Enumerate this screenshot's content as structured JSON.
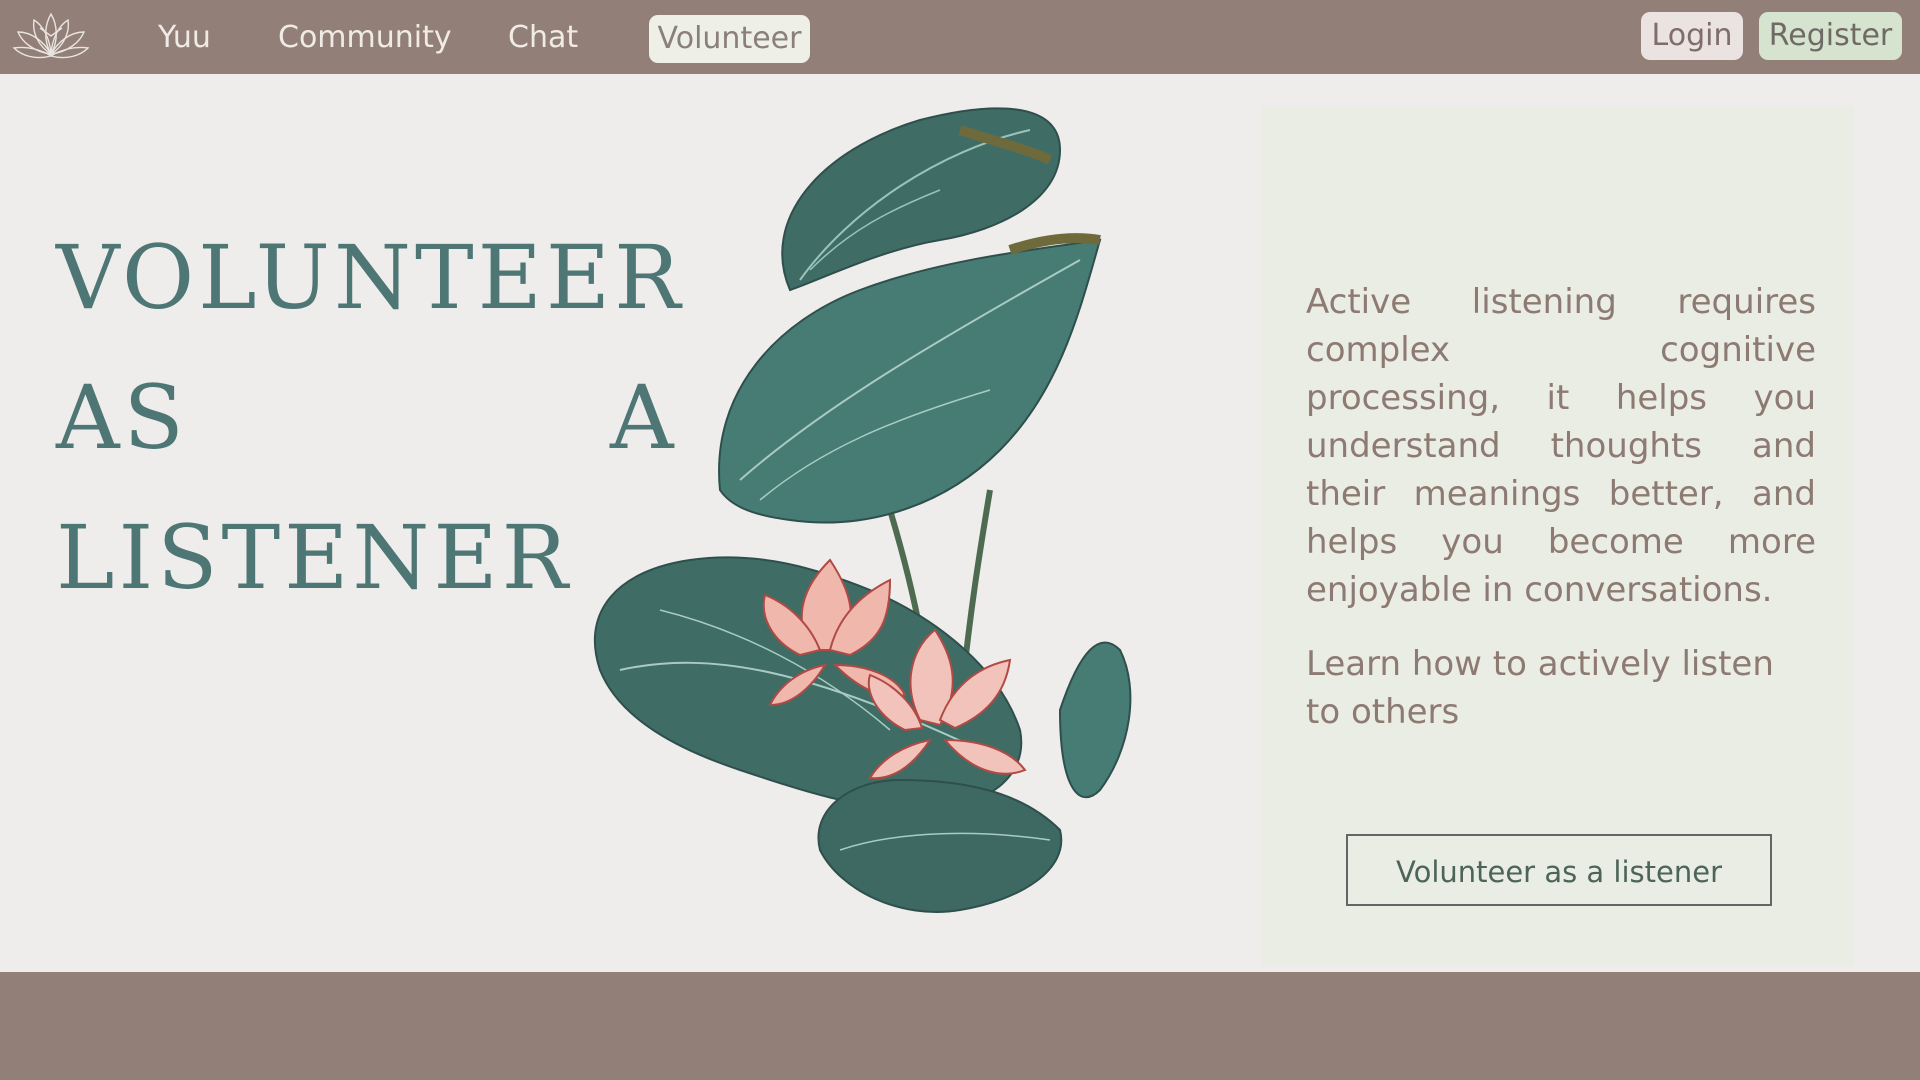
{
  "nav": {
    "logo_icon": "lotus-flower-icon",
    "items": [
      {
        "label": "Yuu"
      },
      {
        "label": "Community"
      },
      {
        "label": "Chat"
      },
      {
        "label": "Volunteer",
        "active": true
      }
    ],
    "login_label": "Login",
    "register_label": "Register"
  },
  "hero": {
    "headline_line1": "VOLUNTEER",
    "headline_line2_left": "AS",
    "headline_line2_right": "A",
    "headline_line3": "LISTENER",
    "illustration": "lotus-leaves-and-flowers-illustration"
  },
  "panel": {
    "description": "Active listening requires complex cognitive processing, it helps you understand thoughts and their meanings better, and helps you become more enjoyable in conversations.",
    "learn_link": "Learn how to actively listen to others",
    "cta_label": "Volunteer as a listener"
  },
  "colors": {
    "topbar": "#927f78",
    "background": "#eeedeb",
    "headline": "#4d7675",
    "panel_bg": "#eaede4",
    "panel_text": "#8d7a72",
    "register_bg": "#d5e3cf",
    "login_bg": "#ebe2e2"
  }
}
